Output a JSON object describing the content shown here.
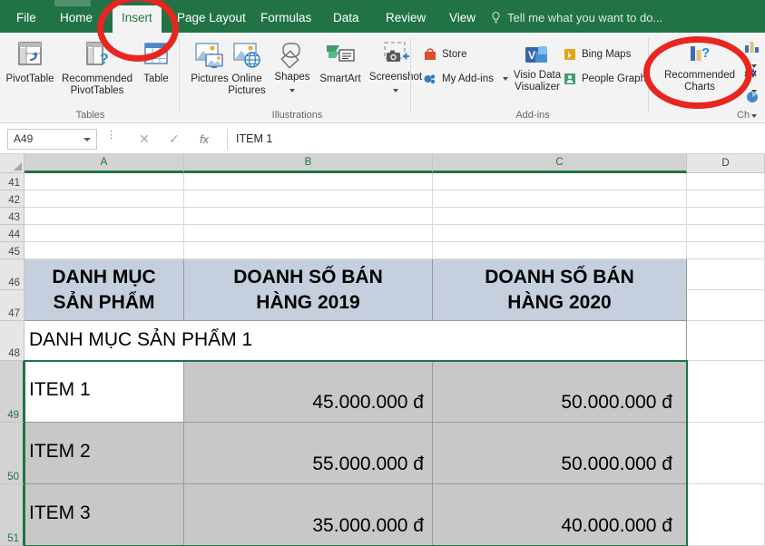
{
  "ribbon": {
    "tabs": [
      {
        "label": "File",
        "active": false
      },
      {
        "label": "Home",
        "active": false
      },
      {
        "label": "Insert",
        "active": true
      },
      {
        "label": "Page Layout",
        "active": false
      },
      {
        "label": "Formulas",
        "active": false
      },
      {
        "label": "Data",
        "active": false
      },
      {
        "label": "Review",
        "active": false
      },
      {
        "label": "View",
        "active": false
      }
    ],
    "tell_me": "Tell me what you want to do...",
    "groups": [
      {
        "name": "Tables"
      },
      {
        "name": "Illustrations"
      },
      {
        "name": "Add-ins"
      },
      {
        "name": "Charts"
      }
    ],
    "buttons": {
      "pivot_table": "PivotTable",
      "recommended_pivot_tables": "Recommended\nPivotTables",
      "recommended_pivot_tables_l1": "Recommended",
      "recommended_pivot_tables_l2": "PivotTables",
      "table": "Table",
      "pictures": "Pictures",
      "online_pictures_l1": "Online",
      "online_pictures_l2": "Pictures",
      "shapes": "Shapes",
      "smartart": "SmartArt",
      "screenshot": "Screenshot",
      "store": "Store",
      "my_add_ins": "My Add-ins",
      "bing_maps": "Bing Maps",
      "visio_data_visualizer_l1": "Visio Data",
      "visio_data_visualizer_l2": "Visualizer",
      "people_graph": "People Graph",
      "recommended_charts_l1": "Recommended",
      "recommended_charts_l2": "Charts",
      "charts_group_clipped": "Ch"
    }
  },
  "formula_bar": {
    "name_box_value": "A49",
    "cancel_icon": "✕",
    "enter_icon": "✓",
    "function_icon": "fx",
    "formula_value": "ITEM 1"
  },
  "grid": {
    "columns": [
      "A",
      "B",
      "C",
      "D"
    ],
    "selected_columns": [
      "A",
      "B",
      "C"
    ],
    "rows": [
      "41",
      "42",
      "43",
      "44",
      "45",
      "46",
      "47",
      "48",
      "49",
      "50",
      "51"
    ],
    "selected_rows": [
      "49",
      "50",
      "51"
    ],
    "table_header": {
      "col_a": "DANH MỤC SẢN PHẨM",
      "col_a_l1": "DANH MỤC",
      "col_a_l2": "SẢN PHẨM",
      "col_b_l1": "DOANH SỐ BÁN",
      "col_b_l2": "HÀNG 2019",
      "col_c_l1": "DOANH SỐ BÁN",
      "col_c_l2": "HÀNG 2020"
    },
    "category_row": "DANH MỤC SẢN PHẨM 1",
    "data_rows": [
      {
        "row": "49",
        "item": "ITEM 1",
        "sales_2019": "45.000.000 đ",
        "sales_2020": "50.000.000 đ"
      },
      {
        "row": "50",
        "item": "ITEM 2",
        "sales_2019": "55.000.000 đ",
        "sales_2020": "50.000.000 đ"
      },
      {
        "row": "51",
        "item": "ITEM 3",
        "sales_2019": "35.000.000 đ",
        "sales_2020": "40.000.000 đ"
      }
    ],
    "active_cell": "A49"
  },
  "annotations": {
    "ring_1_target": "Insert tab",
    "ring_2_target": "Recommended Charts button",
    "color": "#e8251f"
  },
  "colors": {
    "excel_green": "#217346",
    "ribbon_bg": "#f3f3f3",
    "header_fill": "#c6cfdd",
    "selection_fill": "#c8c8c8"
  }
}
